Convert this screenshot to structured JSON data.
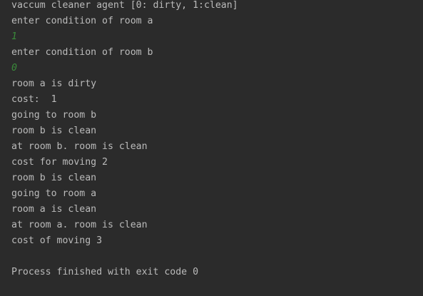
{
  "console": {
    "lines": [
      {
        "text": "vaccum cleaner agent [0: dirty, 1:clean]",
        "kind": "output"
      },
      {
        "text": "enter condition of room a",
        "kind": "output"
      },
      {
        "text": "1",
        "kind": "input"
      },
      {
        "text": "enter condition of room b",
        "kind": "output"
      },
      {
        "text": "0",
        "kind": "input"
      },
      {
        "text": "room a is dirty",
        "kind": "output"
      },
      {
        "text": "cost:  1",
        "kind": "output"
      },
      {
        "text": "going to room b",
        "kind": "output"
      },
      {
        "text": "room b is clean",
        "kind": "output"
      },
      {
        "text": "at room b. room is clean",
        "kind": "output"
      },
      {
        "text": "cost for moving 2",
        "kind": "output"
      },
      {
        "text": "room b is clean",
        "kind": "output"
      },
      {
        "text": "going to room a",
        "kind": "output"
      },
      {
        "text": "room a is clean",
        "kind": "output"
      },
      {
        "text": "at room a. room is clean",
        "kind": "output"
      },
      {
        "text": "cost of moving 3",
        "kind": "output"
      },
      {
        "text": "",
        "kind": "blank"
      },
      {
        "text": "Process finished with exit code 0",
        "kind": "output"
      }
    ]
  },
  "colors": {
    "background": "#2b2b2b",
    "output_text": "#bbbbbb",
    "input_text": "#3a8a3a"
  }
}
